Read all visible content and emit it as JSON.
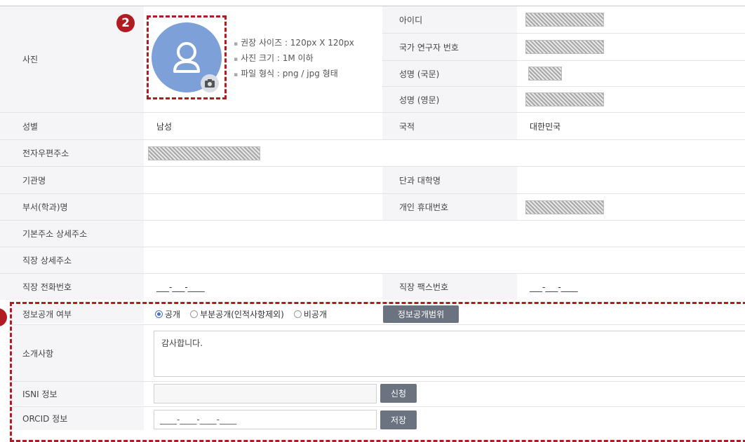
{
  "photo": {
    "label": "사진",
    "badge": "2",
    "hints": [
      "권장 사이즈 : 120px X 120px",
      "사진 크기 : 1M 이하",
      "파일 형식 : png / jpg 형태"
    ]
  },
  "right_fields": {
    "id_label": "아이디",
    "researcher_no_label": "국가 연구자 번호",
    "name_kr_label": "성명 (국문)",
    "name_en_label": "성명 (영문)"
  },
  "rows": {
    "gender_label": "성별",
    "gender_value": "남성",
    "nationality_label": "국적",
    "nationality_value": "대한민국",
    "email_label": "전자우편주소",
    "org_label": "기관명",
    "college_label": "단과 대학명",
    "dept_label": "부서(학과)명",
    "mobile_label": "개인 휴대번호",
    "address_label": "기본주소 상세주소",
    "work_address_label": "직장 상세주소",
    "work_phone_label": "직장 전화번호",
    "work_phone_value": "___-___-____",
    "work_fax_label": "직장 팩스번호",
    "work_fax_value": "___-___-____"
  },
  "privacy": {
    "label": "정보공개 여부",
    "options": [
      "공개",
      "부분공개(인적사항제외)",
      "비공개"
    ],
    "selected": "공개",
    "scope_button": "정보공개범위"
  },
  "intro": {
    "label": "소개사항",
    "value": "감사합니다."
  },
  "isni": {
    "label": "ISNI 정보",
    "button": "신청",
    "value": ""
  },
  "orcid": {
    "label": "ORCID 정보",
    "value": "____-____-____-____",
    "button": "저장"
  }
}
